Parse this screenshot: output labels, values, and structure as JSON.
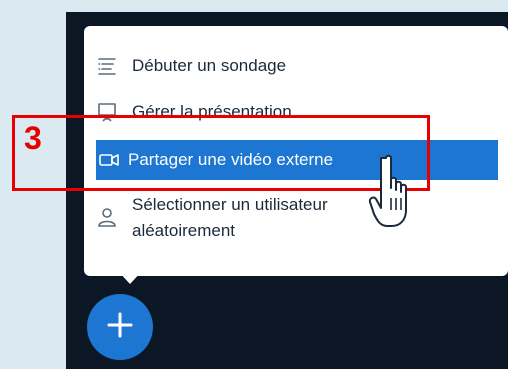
{
  "menu": {
    "items": [
      {
        "label": "Débuter un sondage",
        "icon": "poll-list-icon"
      },
      {
        "label": "Gérer la présentation",
        "icon": "presentation-icon"
      },
      {
        "label": "Partager une vidéo externe",
        "icon": "video-camera-icon"
      },
      {
        "label_line1": "Sélectionner un utilisateur",
        "label_line2": "aléatoirement",
        "icon": "user-icon"
      }
    ]
  },
  "annotation": {
    "number": "3",
    "color": "#e60000"
  },
  "colors": {
    "accent": "#1c76d2",
    "dark_bg": "#0c1726",
    "page_bg": "#dbe9f1"
  },
  "fab": {
    "icon": "plus-icon"
  }
}
